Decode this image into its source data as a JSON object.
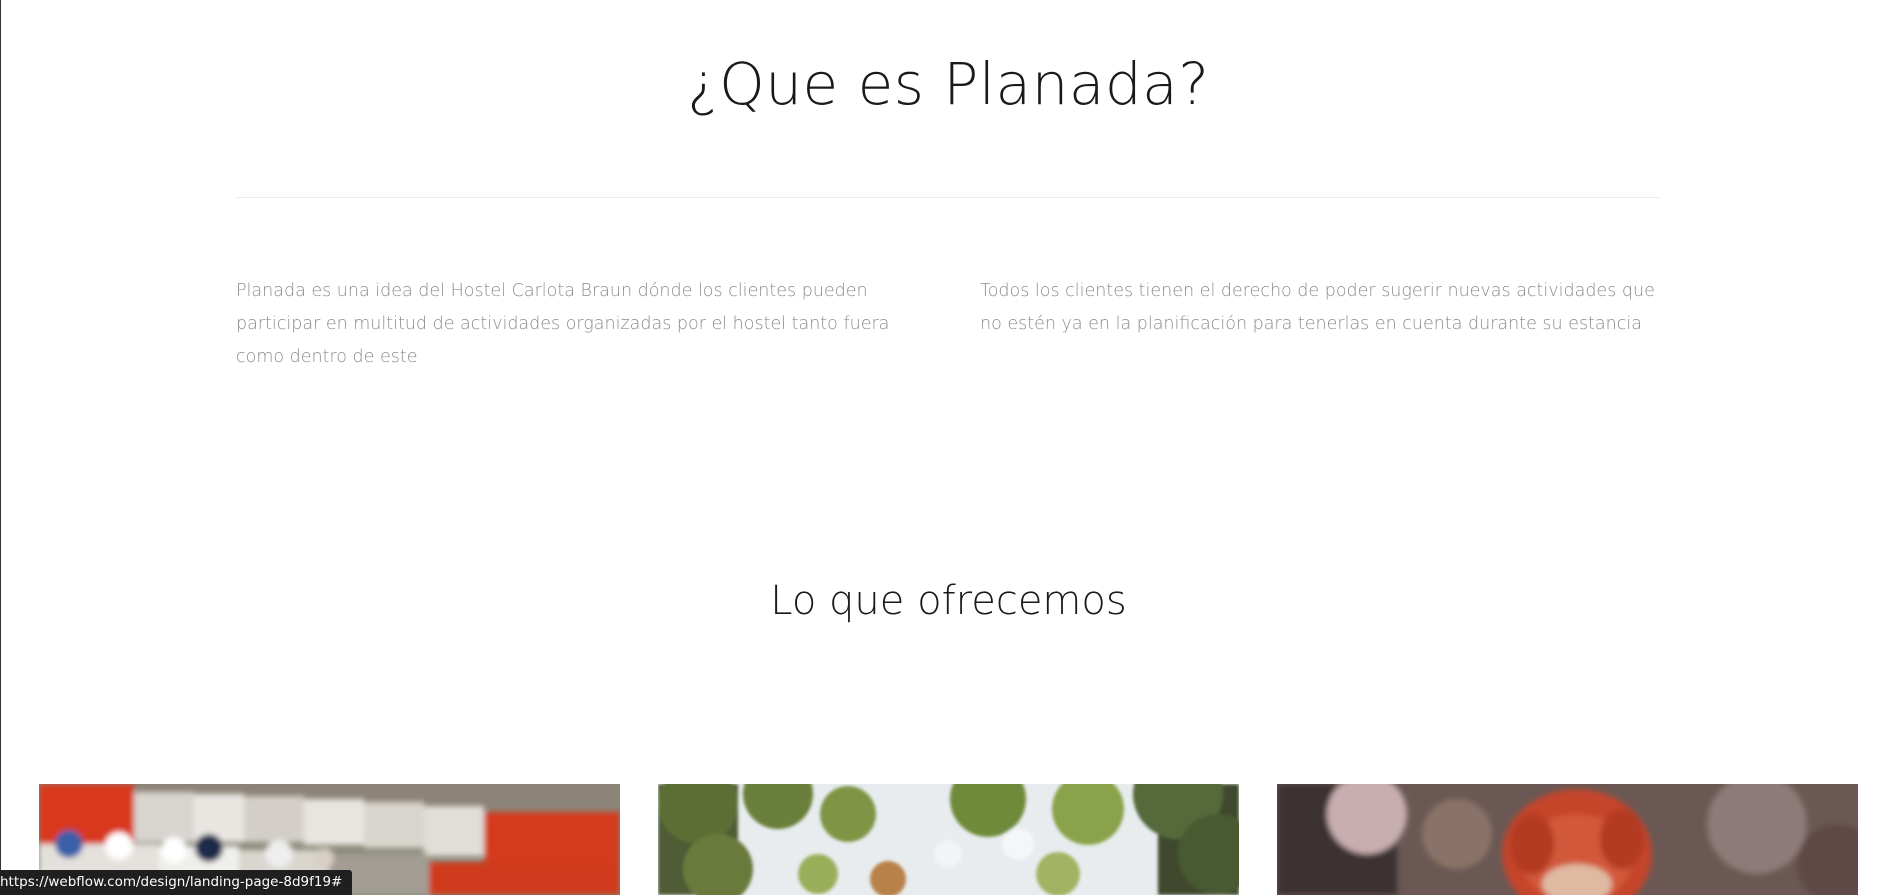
{
  "about": {
    "title": "¿Que es Planada?",
    "paragraph_left": "Planada es una idea del Hostel Carlota Braun dónde los clientes pueden participar en multitud de actividades organizadas por el hostel tanto fuera como dentro de este",
    "paragraph_right": "Todos los clientes tienen el derecho de poder sugerir nuevas actividades que no estén ya en la planificación para tenerlas en cuenta durante su estancia"
  },
  "offer": {
    "title": "Lo que ofrecemos",
    "cards": [
      {
        "image": "go-kart-racing-photo"
      },
      {
        "image": "forest-trees-photo"
      },
      {
        "image": "red-haired-person-photo"
      }
    ]
  },
  "status_bar": {
    "url": "https://webflow.com/design/landing-page-8d9f19#"
  }
}
